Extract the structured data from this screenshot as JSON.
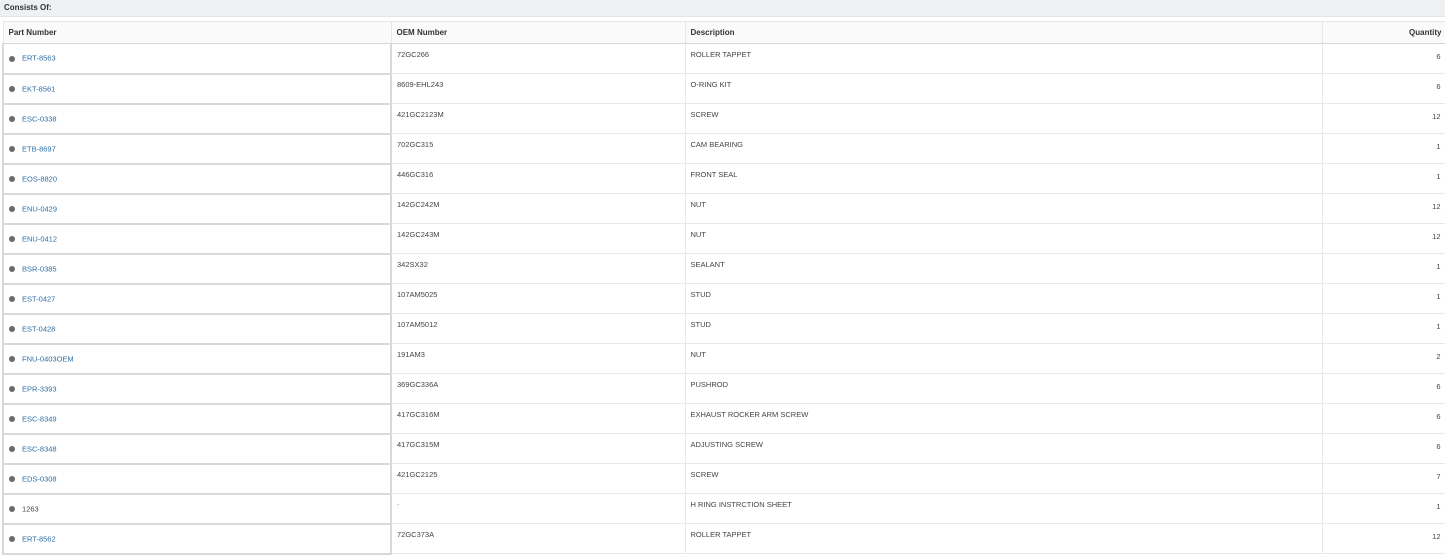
{
  "section": {
    "title": "Consists Of:"
  },
  "columns": {
    "part_number": "Part Number",
    "oem_number": "OEM Number",
    "description": "Description",
    "quantity": "Quantity"
  },
  "rows": [
    {
      "part": "ERT-8563",
      "link": true,
      "oem": "72GC266",
      "desc": "ROLLER TAPPET",
      "qty": "6"
    },
    {
      "part": "EKT-8561",
      "link": true,
      "oem": "8609-EHL243",
      "desc": "O-RING KIT",
      "qty": "6"
    },
    {
      "part": "ESC-0338",
      "link": true,
      "oem": "421GC2123M",
      "desc": "SCREW",
      "qty": "12"
    },
    {
      "part": "ETB-8697",
      "link": true,
      "oem": "702GC315",
      "desc": "CAM BEARING",
      "qty": "1"
    },
    {
      "part": "EOS-8820",
      "link": true,
      "oem": "446GC316",
      "desc": "FRONT SEAL",
      "qty": "1"
    },
    {
      "part": "ENU-0429",
      "link": true,
      "oem": "142GC242M",
      "desc": "NUT",
      "qty": "12"
    },
    {
      "part": "ENU-0412",
      "link": true,
      "oem": "142GC243M",
      "desc": "NUT",
      "qty": "12"
    },
    {
      "part": "BSR-0385",
      "link": true,
      "oem": "342SX32",
      "desc": "SEALANT",
      "qty": "1"
    },
    {
      "part": "EST-0427",
      "link": true,
      "oem": "107AM5025",
      "desc": "STUD",
      "qty": "1"
    },
    {
      "part": "EST-0428",
      "link": true,
      "oem": "107AM5012",
      "desc": "STUD",
      "qty": "1"
    },
    {
      "part": "FNU-0403OEM",
      "link": true,
      "oem": "191AM3",
      "desc": "NUT",
      "qty": "2"
    },
    {
      "part": "EPR-3393",
      "link": true,
      "oem": "369GC336A",
      "desc": "PUSHROD",
      "qty": "6"
    },
    {
      "part": "ESC-8349",
      "link": true,
      "oem": "417GC316M",
      "desc": "EXHAUST ROCKER ARM SCREW",
      "qty": "6"
    },
    {
      "part": "ESC-8348",
      "link": true,
      "oem": "417GC315M",
      "desc": "ADJUSTING SCREW",
      "qty": "6"
    },
    {
      "part": "EDS-0308",
      "link": true,
      "oem": "421GC2125",
      "desc": "SCREW",
      "qty": "7"
    },
    {
      "part": "1263",
      "link": false,
      "oem": "-",
      "desc": "H RING INSTRCTION SHEET",
      "qty": "1"
    },
    {
      "part": "ERT-8562",
      "link": true,
      "oem": "72GC373A",
      "desc": "ROLLER TAPPET",
      "qty": "12"
    }
  ]
}
